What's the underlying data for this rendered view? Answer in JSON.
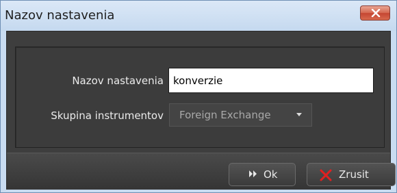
{
  "window": {
    "title": "Nazov nastavenia",
    "close_icon": "close-x-icon"
  },
  "form": {
    "name_label": "Nazov nastavenia",
    "name_value": "konverzie",
    "group_label": "Skupina instrumentov",
    "group_value": "Foreign Exchange",
    "group_dropdown_icon": "caret-down-icon"
  },
  "buttons": {
    "ok_label": "Ok",
    "ok_icon": "double-arrow-right-icon",
    "cancel_label": "Zrusit",
    "cancel_icon": "red-x-icon"
  },
  "colors": {
    "close_button": "#d05a40",
    "cancel_icon": "#e02020",
    "panel_bg": "#3c3c3c"
  }
}
